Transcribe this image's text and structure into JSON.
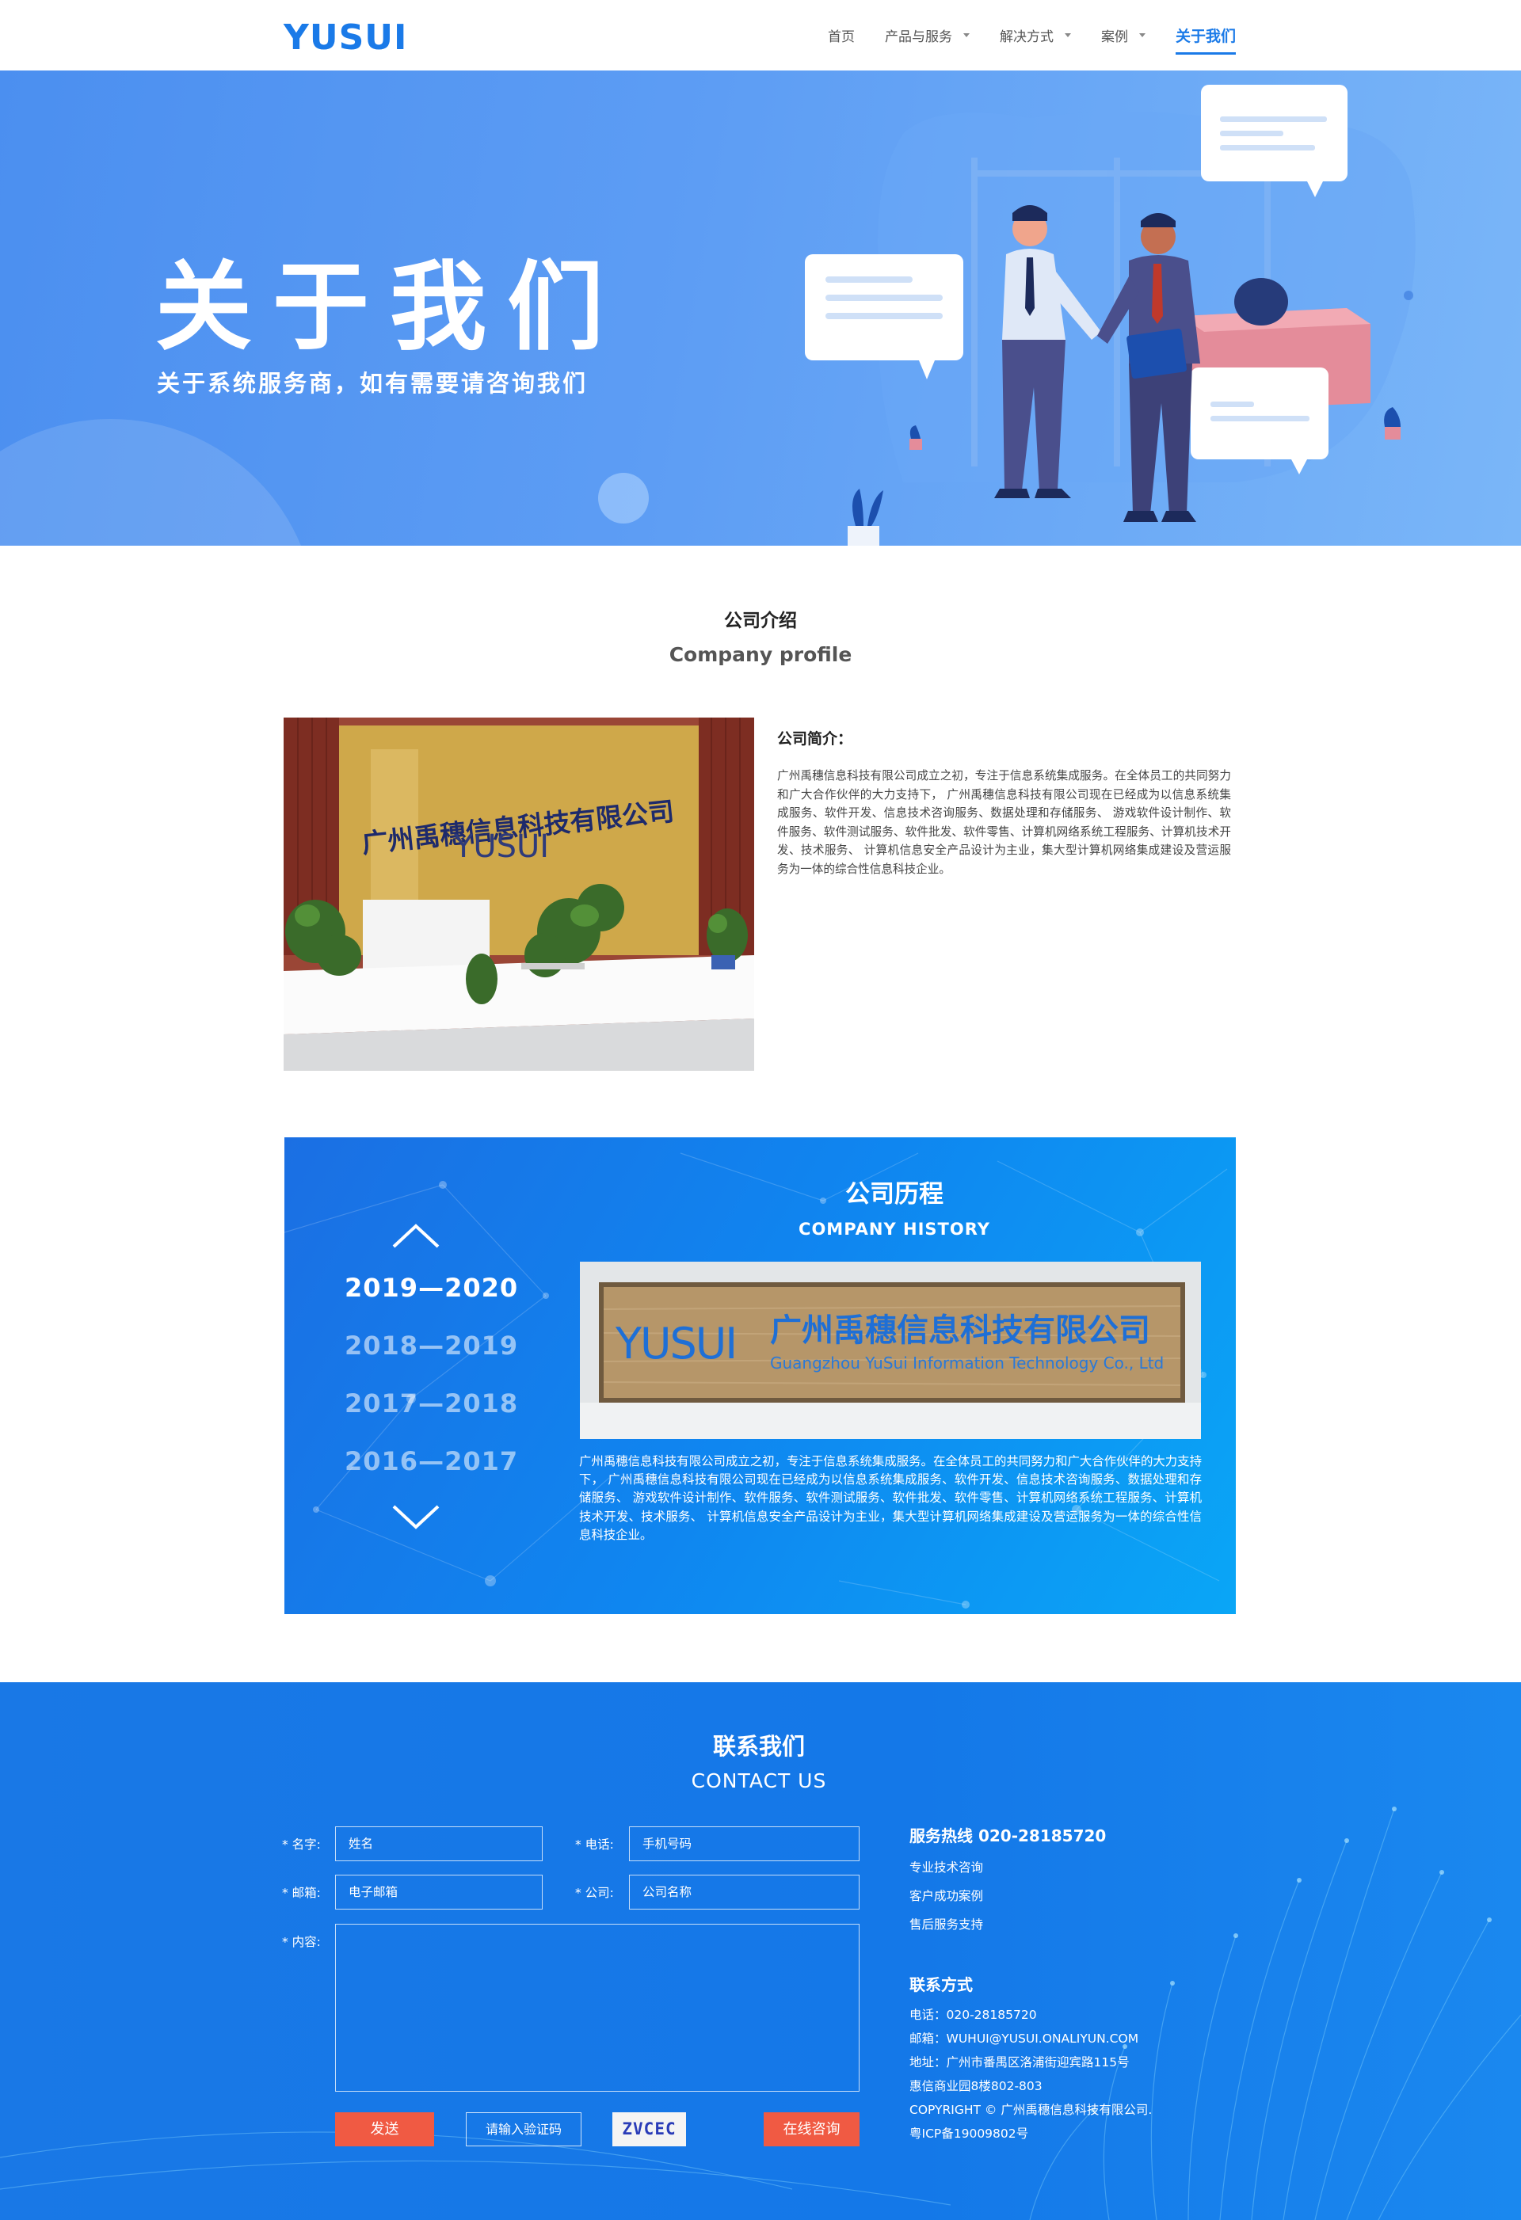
{
  "header": {
    "logo": "YUSUI",
    "nav": [
      {
        "label": "首页",
        "dropdown": false,
        "active": false
      },
      {
        "label": "产品与服务",
        "dropdown": true,
        "active": false
      },
      {
        "label": "解决方式",
        "dropdown": true,
        "active": false
      },
      {
        "label": "案例",
        "dropdown": true,
        "active": false
      },
      {
        "label": "关于我们",
        "dropdown": false,
        "active": true
      }
    ]
  },
  "hero": {
    "title": "关于我们",
    "subtitle": "关于系统服务商，如有需要请咨询我们"
  },
  "profile": {
    "title_cn": "公司介绍",
    "title_en": "Company profile",
    "text_title": "公司简介：",
    "text": "广州禹穗信息科技有限公司成立之初，专注于信息系统集成服务。在全体员工的共同努力和广大合作伙伴的大力支持下，  广州禹穗信息科技有限公司现在已经成为以信息系统集成服务、软件开发、信息技术咨询服务、数据处理和存储服务、  游戏软件设计制作、软件服务、软件测试服务、软件批发、软件零售、计算机网络系统工程服务、计算机技术开发、技术服务、  计算机信息安全产品设计为主业，集大型计算机网络集成建设及营运服务为一体的综合性信息科技企业。",
    "photo_sign_text": "广州禹穗信息科技有限公司",
    "photo_logo_text": "YUSUI"
  },
  "history": {
    "title_cn": "公司历程",
    "title_en": "COMPANY HISTORY",
    "years": [
      {
        "label": "2019—2020",
        "active": true
      },
      {
        "label": "2018—2019",
        "active": false
      },
      {
        "label": "2017—2018",
        "active": false
      },
      {
        "label": "2016—2017",
        "active": false
      }
    ],
    "photo_logo": "YUSUI",
    "photo_cn": "广州禹穗信息科技有限公司",
    "photo_en": "Guangzhou YuSui Information Technology Co., Ltd",
    "text": "广州禹穗信息科技有限公司成立之初，专注于信息系统集成服务。在全体员工的共同努力和广大合作伙伴的大力支持下，  广州禹穗信息科技有限公司现在已经成为以信息系统集成服务、软件开发、信息技术咨询服务、数据处理和存储服务、  游戏软件设计制作、软件服务、软件测试服务、软件批发、软件零售、计算机网络系统工程服务、计算机技术开发、技术服务、  计算机信息安全产品设计为主业，集大型计算机网络集成建设及营运服务为一体的综合性信息科技企业。"
  },
  "contact": {
    "title_cn": "联系我们",
    "title_en": "CONTACT US",
    "form": {
      "name_label": "* 名字:",
      "name_placeholder": "姓名",
      "phone_label": "* 电话:",
      "phone_placeholder": "手机号码",
      "email_label": "* 邮箱:",
      "email_placeholder": "电子邮箱",
      "company_label": "* 公司:",
      "company_placeholder": "公司名称",
      "content_label": "* 内容:",
      "send_label": "发送",
      "captcha_placeholder": "请输入验证码",
      "captcha_code": "ZVCEC",
      "online_label": "在线咨询"
    },
    "info": {
      "hotline": "服务热线 020-28185720",
      "services": [
        "专业技术咨询",
        "客户成功案例",
        "售后服务支持"
      ],
      "contact_head": "联系方式",
      "lines": [
        "电话：020-28185720",
        "邮箱：WUHUI@YUSUI.ONALIYUN.COM",
        "地址：广州市番禺区洛浦街迎宾路115号",
        "惠信商业园8楼802-803",
        "COPYRIGHT © 广州禹穗信息科技有限公司.",
        "粤ICP备19009802号"
      ]
    }
  },
  "colors": {
    "brand_blue": "#1a7ae8",
    "hero_blue": "#5d9df4",
    "history_blue": "#0f86f0",
    "button_red": "#f05a43"
  }
}
